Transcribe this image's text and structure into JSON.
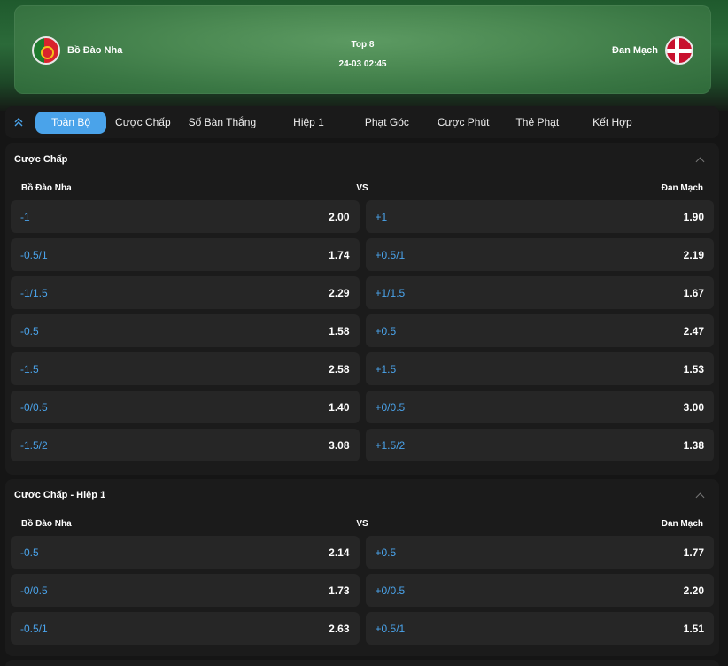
{
  "match": {
    "home": "Bồ Đào Nha",
    "away": "Đan Mạch",
    "stage": "Top 8",
    "datetime": "24-03 02:45"
  },
  "tabs": [
    {
      "label": "Toàn Bộ",
      "active": true
    },
    {
      "label": "Cược Chấp",
      "active": false
    },
    {
      "label": "Số Bàn Thắng",
      "active": false
    },
    {
      "label": "Hiệp 1",
      "active": false
    },
    {
      "label": "Phạt Góc",
      "active": false
    },
    {
      "label": "Cược Phút",
      "active": false
    },
    {
      "label": "Thẻ Phạt",
      "active": false
    },
    {
      "label": "Kết Hợp",
      "active": false
    }
  ],
  "icons": {
    "collapse": "double-chevron-up-icon",
    "section_toggle": "chevron-up-icon"
  },
  "colors": {
    "accent": "#4aa3ea",
    "card": "#262626",
    "section": "#1b1b1b"
  },
  "sections": [
    {
      "title": "Cược Chấp",
      "home_label": "Bồ Đào Nha",
      "vs": "VS",
      "away_label": "Đan Mạch",
      "rows": [
        {
          "home_line": "-1",
          "home_odds": "2.00",
          "away_line": "+1",
          "away_odds": "1.90"
        },
        {
          "home_line": "-0.5/1",
          "home_odds": "1.74",
          "away_line": "+0.5/1",
          "away_odds": "2.19"
        },
        {
          "home_line": "-1/1.5",
          "home_odds": "2.29",
          "away_line": "+1/1.5",
          "away_odds": "1.67"
        },
        {
          "home_line": "-0.5",
          "home_odds": "1.58",
          "away_line": "+0.5",
          "away_odds": "2.47"
        },
        {
          "home_line": "-1.5",
          "home_odds": "2.58",
          "away_line": "+1.5",
          "away_odds": "1.53"
        },
        {
          "home_line": "-0/0.5",
          "home_odds": "1.40",
          "away_line": "+0/0.5",
          "away_odds": "3.00"
        },
        {
          "home_line": "-1.5/2",
          "home_odds": "3.08",
          "away_line": "+1.5/2",
          "away_odds": "1.38"
        }
      ]
    },
    {
      "title": "Cược Chấp - Hiệp 1",
      "home_label": "Bồ Đào Nha",
      "vs": "VS",
      "away_label": "Đan Mạch",
      "rows": [
        {
          "home_line": "-0.5",
          "home_odds": "2.14",
          "away_line": "+0.5",
          "away_odds": "1.77"
        },
        {
          "home_line": "-0/0.5",
          "home_odds": "1.73",
          "away_line": "+0/0.5",
          "away_odds": "2.20"
        },
        {
          "home_line": "-0.5/1",
          "home_odds": "2.63",
          "away_line": "+0.5/1",
          "away_odds": "1.51"
        }
      ]
    }
  ]
}
